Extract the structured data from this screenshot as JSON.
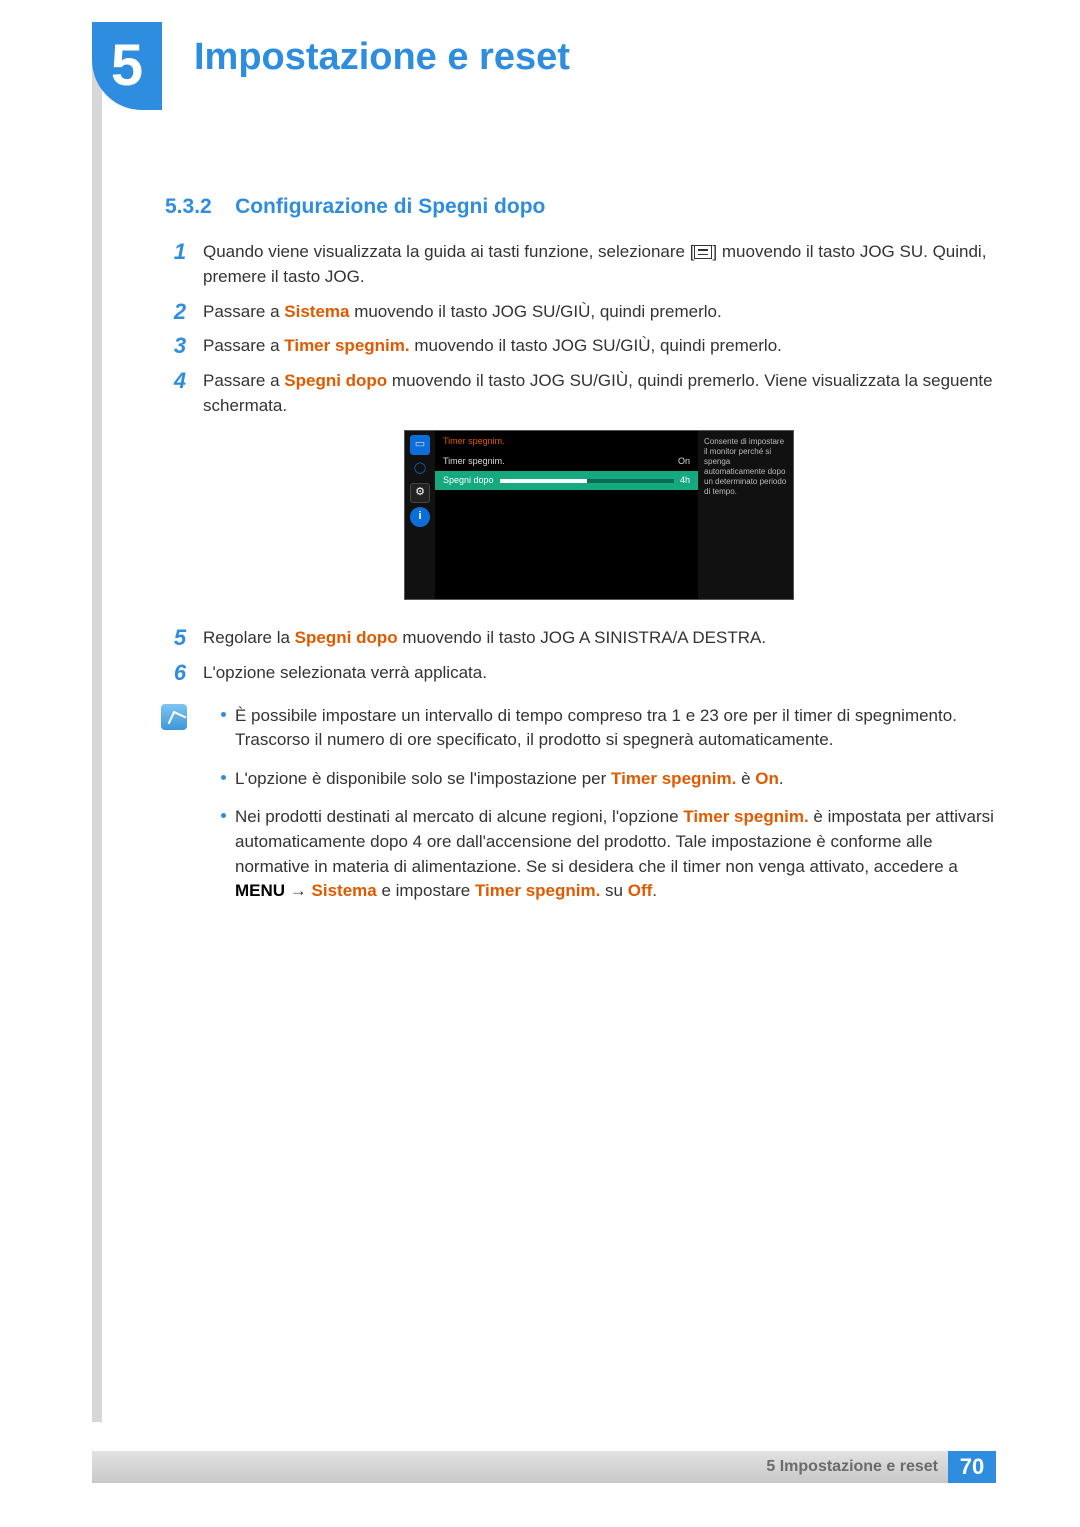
{
  "chapter": {
    "number": "5",
    "title": "Impostazione e reset"
  },
  "subsection": {
    "number": "5.3.2",
    "title": "Configurazione di Spegni dopo"
  },
  "steps": {
    "s1a": "Quando viene visualizzata la guida ai tasti funzione, selezionare [",
    "s1b": "] muovendo il tasto JOG SU. Quindi, premere il tasto JOG.",
    "s2a": "Passare a ",
    "s2_sistema": "Sistema",
    "s2b": " muovendo il tasto JOG SU/GIÙ, quindi premerlo.",
    "s3a": "Passare a ",
    "s3_timer": "Timer spegnim.",
    "s3b": " muovendo il tasto JOG SU/GIÙ, quindi premerlo.",
    "s4a": "Passare a ",
    "s4_spegni": "Spegni dopo",
    "s4b": " muovendo il tasto JOG SU/GIÙ, quindi premerlo. Viene visualizzata la seguente schermata.",
    "s5a": "Regolare la ",
    "s5_spegni": "Spegni dopo",
    "s5b": " muovendo il tasto JOG A SINISTRA/A DESTRA.",
    "s6": "L'opzione selezionata verrà applicata."
  },
  "osd": {
    "header": "Timer spegnim.",
    "row1_label": "Timer spegnim.",
    "row1_value": "On",
    "row2_label": "Spegni dopo",
    "row2_value": "4h",
    "desc": "Consente di impostare il monitor perché si spenga automaticamente dopo un determinato periodo di tempo."
  },
  "notes": {
    "n1": "È possibile impostare un intervallo di tempo compreso tra 1 e 23 ore per il timer di spegnimento. Trascorso il numero di ore specificato, il prodotto si spegnerà automaticamente.",
    "n2a": "L'opzione è disponibile solo se l'impostazione per ",
    "n2_timer": "Timer spegnim.",
    "n2_mid": " è ",
    "n2_on": "On",
    "n2_end": ".",
    "n3a": "Nei prodotti destinati al mercato di alcune regioni, l'opzione ",
    "n3_timer": "Timer spegnim.",
    "n3b": " è impostata per attivarsi automaticamente dopo 4 ore dall'accensione del prodotto. Tale impostazione è conforme alle normative in materia di alimentazione. Se si desidera che il timer non venga attivato, accedere a ",
    "n3_menu": "MENU",
    "n3_arrow": " → ",
    "n3_sistema": "Sistema",
    "n3c": " e impostare ",
    "n3_timer2": "Timer spegnim.",
    "n3d": " su ",
    "n3_off": "Off",
    "n3_end": "."
  },
  "footer": {
    "label": "5 Impostazione e reset",
    "page": "70"
  }
}
